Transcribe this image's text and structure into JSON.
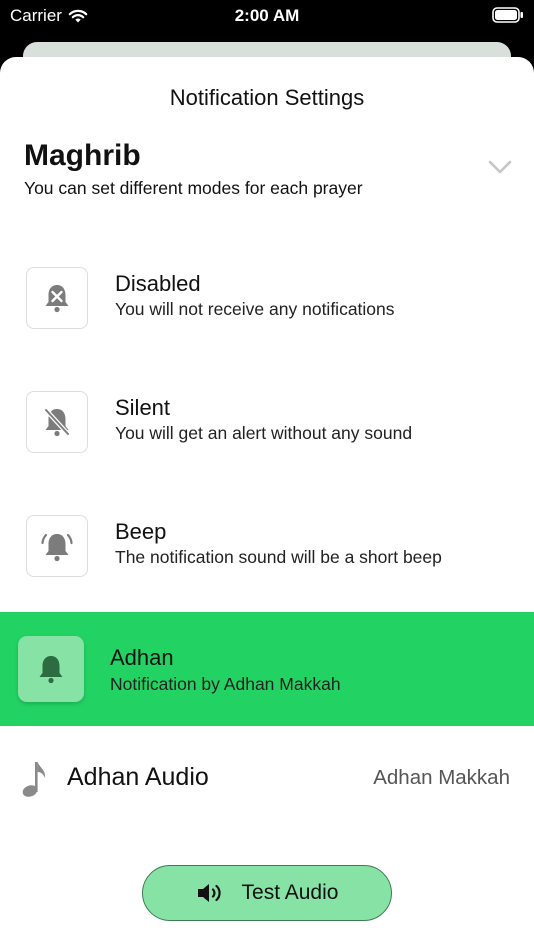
{
  "status_bar": {
    "carrier": "Carrier",
    "time": "2:00 AM"
  },
  "sheet": {
    "title": "Notification Settings"
  },
  "prayer": {
    "name": "Maghrib",
    "subtitle": "You can set different modes for each prayer"
  },
  "modes": [
    {
      "title": "Disabled",
      "description": "You will not receive any notifications",
      "icon": "bell-x-icon"
    },
    {
      "title": "Silent",
      "description": "You will get an alert without any sound",
      "icon": "bell-slash-icon"
    },
    {
      "title": "Beep",
      "description": "The notification sound will be a short beep",
      "icon": "bell-ring-icon"
    },
    {
      "title": "Adhan",
      "description": "Notification by Adhan Makkah",
      "icon": "bell-icon",
      "selected": true
    }
  ],
  "audio": {
    "label": "Adhan Audio",
    "value": "Adhan Makkah",
    "icon": "music-note-icon"
  },
  "test_button": {
    "label": "Test Audio",
    "icon": "speaker-icon"
  },
  "colors": {
    "selected": "#22d364",
    "accent_light": "#86e3a5",
    "icon_dark": "#2d6b40"
  }
}
